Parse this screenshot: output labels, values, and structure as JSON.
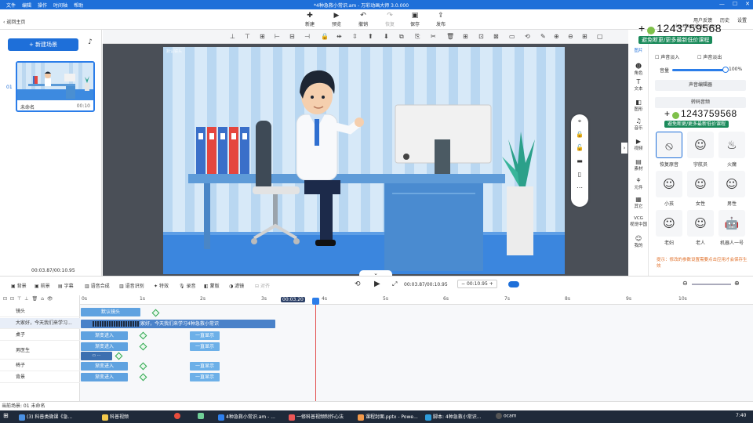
{
  "menubar": {
    "items": [
      "文件",
      "编辑",
      "操作",
      "时间轴",
      "帮助"
    ],
    "title": "*4种急救小常识.am - 万彩动画大师 3.0.000",
    "win": [
      "—",
      "☐",
      "✕"
    ]
  },
  "toolbar": {
    "new": "新建",
    "preview": "预览",
    "undo": "撤销",
    "redo": "恢复",
    "save": "保存",
    "publish": "发布"
  },
  "user": {
    "feedback": "用户反馈",
    "email": "yixuclass@qq.com",
    "history": "历史",
    "settings": "设置"
  },
  "left": {
    "back": "返回主页",
    "new_scene": "新建场景",
    "scene": {
      "index": "01",
      "name": "未命名",
      "duration": "00:10"
    },
    "time": "00:03.87/00:10.95"
  },
  "stage": {
    "watermark": "默认镜头"
  },
  "promo": {
    "qq": "1243759568",
    "tag": "避免断更/更多最新低价课程"
  },
  "rightnav": [
    {
      "icon": "picture",
      "label": "图片"
    },
    {
      "icon": "role",
      "label": "角色"
    },
    {
      "icon": "text",
      "label": "文本"
    },
    {
      "icon": "shape",
      "label": "图形"
    },
    {
      "icon": "music",
      "label": "音乐"
    },
    {
      "icon": "video",
      "label": "视频"
    },
    {
      "icon": "material",
      "label": "素材"
    },
    {
      "icon": "component",
      "label": "元件"
    },
    {
      "icon": "other",
      "label": "其它"
    },
    {
      "icon": "vcg",
      "label": "VCG\n视觉中国"
    },
    {
      "icon": "mine",
      "label": "我的"
    }
  ],
  "voice": {
    "fade_in": "声音淡入",
    "fade_out": "声音淡出",
    "volume_label": "音量",
    "volume": 100,
    "volume_text": "100%",
    "editor": "声音编辑器",
    "convert": "转码音频",
    "voices": [
      {
        "label": "恢复原音",
        "icon": "⦸"
      },
      {
        "label": "宇航员",
        "icon": "☺"
      },
      {
        "label": "火魔",
        "icon": "♨"
      },
      {
        "label": "小孩",
        "icon": "☺"
      },
      {
        "label": "女性",
        "icon": "☺"
      },
      {
        "label": "男性",
        "icon": "☺"
      },
      {
        "label": "老妇",
        "icon": "☺"
      },
      {
        "label": "老人",
        "icon": "☺"
      },
      {
        "label": "机器人一号",
        "icon": "☺"
      }
    ],
    "tip": "提示：修改的参数设置需要点击应用才会保存生效"
  },
  "timeline_toolbar": {
    "items": [
      "背景",
      "前景",
      "字幕",
      "语音合成",
      "语音识别",
      "特效",
      "录音",
      "蒙版",
      "滤镜",
      "对齐"
    ],
    "time": "00:03.87/00:10.95",
    "duration": "00:10.95"
  },
  "timeline": {
    "ticks": [
      "0s",
      "1s",
      "2s",
      "3s",
      "4s",
      "5s",
      "6s",
      "7s",
      "8s",
      "9s",
      "10s"
    ],
    "current_label": "00:03.20",
    "rows": [
      {
        "name": "镜头",
        "blocks": [
          {
            "label": "默认镜头",
            "color": "#5fa2e0"
          }
        ]
      },
      {
        "name": "大家好，今天我们来学习...",
        "blocks": [
          {
            "label": "大家好，今天我们来学习4种急救小常识",
            "color": "#4a82c9"
          }
        ]
      },
      {
        "name": "桌子",
        "blocks": [
          {
            "label": "渐变进入",
            "color": "#5fa2e0"
          },
          {
            "label": "一直显示",
            "color": "#6db0e8"
          }
        ]
      },
      {
        "name": "男医生",
        "blocks": [
          {
            "label": "渐变进入",
            "color": "#5fa2e0"
          },
          {
            "label": "一直显示",
            "color": "#6db0e8"
          }
        ]
      },
      {
        "name": "椅子",
        "blocks": [
          {
            "label": "渐变进入",
            "color": "#5fa2e0"
          },
          {
            "label": "一直显示",
            "color": "#6db0e8"
          }
        ]
      },
      {
        "name": "背景",
        "blocks": [
          {
            "label": "渐变进入",
            "color": "#5fa2e0"
          },
          {
            "label": "一直显示",
            "color": "#6db0e8"
          }
        ]
      }
    ]
  },
  "status": {
    "text": "当前场景: 01  未命名"
  },
  "taskbar": {
    "items": [
      "(3) 科普类微课《急...",
      "科普视频",
      "4种急救小常识.am - ...",
      "一修科普视频制作心法",
      "课程封面.pptx - Powe...",
      "脚本: 4种急救小常识...",
      "ocam"
    ],
    "clock": "7:40"
  }
}
